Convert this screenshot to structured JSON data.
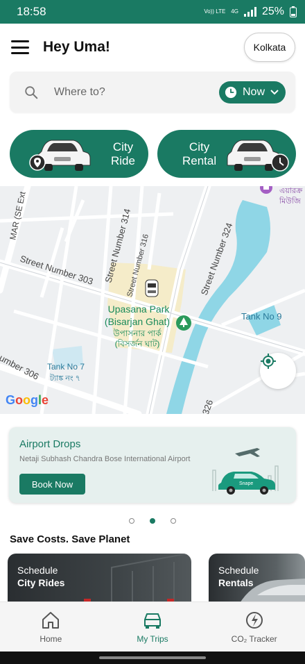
{
  "status": {
    "time": "18:58",
    "network_top": "Vo)) LTE",
    "network_bottom": "4G",
    "battery": "25%"
  },
  "header": {
    "greeting": "Hey Uma!",
    "city": "Kolkata"
  },
  "search": {
    "placeholder": "Where to?",
    "time_option": "Now"
  },
  "ride_options": [
    {
      "label_line1": "City",
      "label_line2": "Ride"
    },
    {
      "label_line1": "City",
      "label_line2": "Rental"
    }
  ],
  "map": {
    "labels": {
      "street_314": "Street Number 314",
      "street_316": "Street Number 316",
      "street_324": "Street Number 324",
      "street_303": "Street Number 303",
      "street_306": "umber 306",
      "street_326": "326",
      "mar_se": "MAR (SE Ext",
      "park_en_1": "Upasana Park",
      "park_en_2": "(Bisarjan Ghat)",
      "park_bn_1": "উপাসনার পার্ক",
      "park_bn_2": "(বিসর্জন ঘাট)",
      "tank9": "Tank No 9",
      "tank7": "Tank No 7",
      "tank7_bn": "ট্যাঙ্ক নং ৭",
      "museum_bn_1": "এয়ারক্র",
      "museum_bn_2": "মিউজি",
      "google": "Google"
    }
  },
  "airport_card": {
    "title": "Airport Drops",
    "subtitle": "Netaji Subhash Chandra Bose International Airport",
    "button": "Book Now",
    "car_brand": "Snape"
  },
  "carousel": {
    "count": 3,
    "active_index": 1
  },
  "section": {
    "title": "Save Costs. Save Planet"
  },
  "promos": [
    {
      "line1": "Schedule",
      "line2": "City Rides"
    },
    {
      "line1": "Schedule",
      "line2": "Rentals"
    }
  ],
  "bottom_nav": [
    {
      "label": "Home",
      "icon": "home-icon"
    },
    {
      "label": "My Trips",
      "icon": "car-icon"
    },
    {
      "label": "CO₂ Tracker",
      "icon": "co2-leaf-icon"
    }
  ],
  "colors": {
    "brand": "#1a7a63",
    "map_water": "#8fd6e6",
    "map_park": "#f5ecc9"
  }
}
